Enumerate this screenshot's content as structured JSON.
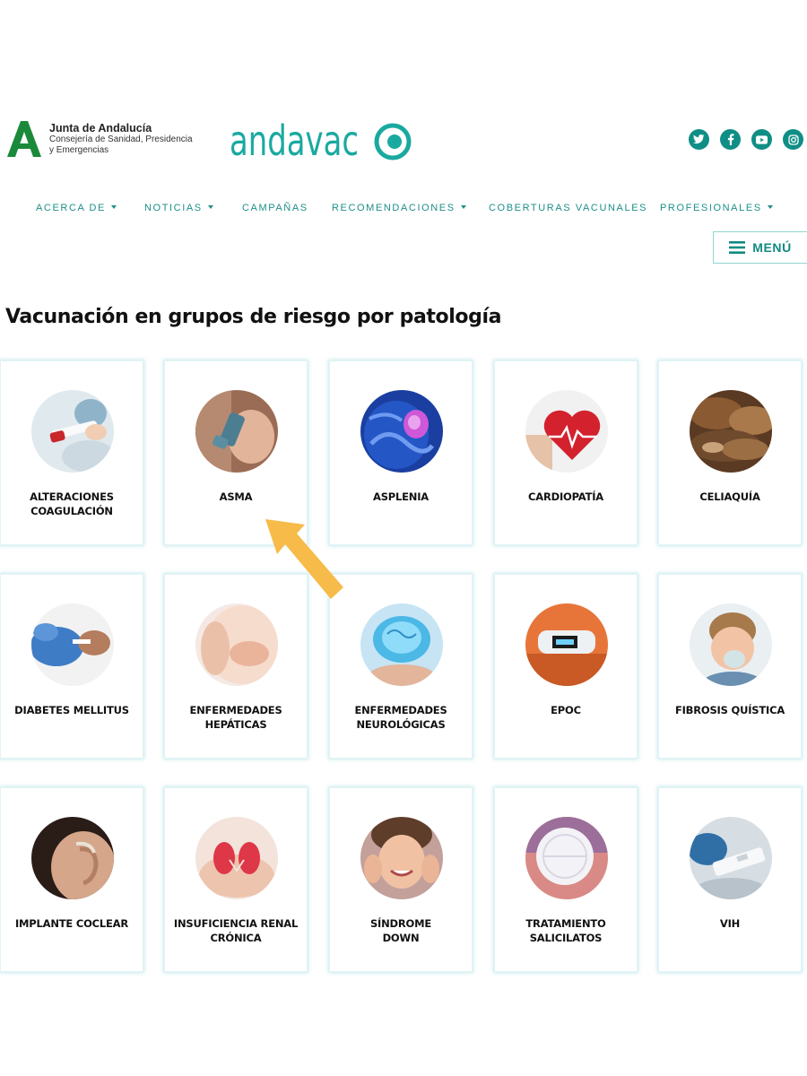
{
  "header": {
    "org_title": "Junta de Andalucía",
    "org_subtitle_line1": "Consejería de Sanidad, Presidencia",
    "org_subtitle_line2": "y Emergencias",
    "brand_logo_text": "andavac",
    "social_icons": [
      "twitter-icon",
      "facebook-icon",
      "youtube-icon",
      "instagram-icon"
    ]
  },
  "nav": {
    "items": [
      {
        "label": "ACERCA DE",
        "dropdown": true
      },
      {
        "label": "NOTICIAS",
        "dropdown": true
      },
      {
        "label": "CAMPAÑAS",
        "dropdown": false
      },
      {
        "label": "RECOMENDACIONES",
        "dropdown": true
      },
      {
        "label": "COBERTURAS VACUNALES",
        "dropdown": false
      },
      {
        "label": "PROFESIONALES",
        "dropdown": true
      }
    ],
    "menu_button": "MENÚ"
  },
  "page": {
    "title": "Vacunación en grupos de riesgo por patología"
  },
  "cards": [
    {
      "line1": "ALTERACIONES",
      "line2": "COAGULACIÓN"
    },
    {
      "line1": "ASMA",
      "line2": ""
    },
    {
      "line1": "ASPLENIA",
      "line2": ""
    },
    {
      "line1": "CARDIOPATÍA",
      "line2": ""
    },
    {
      "line1": "CELIAQUÍA",
      "line2": ""
    },
    {
      "line1": "DIABETES MELLITUS",
      "line2": ""
    },
    {
      "line1": "ENFERMEDADES",
      "line2": "HEPÁTICAS"
    },
    {
      "line1": "ENFERMEDADES",
      "line2": "NEUROLÓGICAS"
    },
    {
      "line1": "EPOC",
      "line2": ""
    },
    {
      "line1": "FIBROSIS QUÍSTICA",
      "line2": ""
    },
    {
      "line1": "IMPLANTE COCLEAR",
      "line2": ""
    },
    {
      "line1": "INSUFICIENCIA RENAL",
      "line2": "CRÓNICA"
    },
    {
      "line1": "SÍNDROME",
      "line2": "DOWN"
    },
    {
      "line1": "TRATAMIENTO",
      "line2": "SALICILATOS"
    },
    {
      "line1": "VIH",
      "line2": ""
    }
  ],
  "colors": {
    "brand_teal": "#1aa9a0",
    "nav_text": "#1d8f88",
    "social_bg": "#0f8e86",
    "highlight_arrow": "#f6bb49",
    "card_border": "#96d7de"
  }
}
